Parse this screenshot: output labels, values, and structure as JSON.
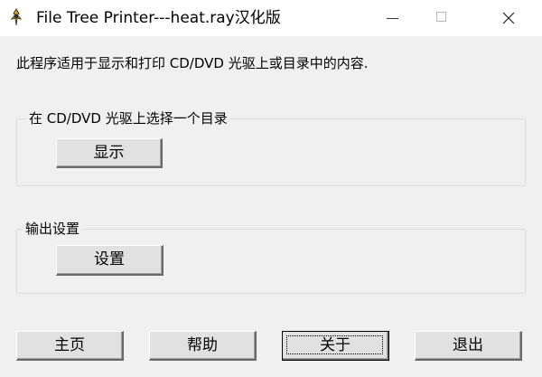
{
  "window": {
    "title": "File Tree Printer---heat.ray汉化版",
    "icons": {
      "app": "app-icon",
      "minimize": "minimize-icon",
      "maximize": "maximize-icon",
      "close": "close-icon"
    }
  },
  "main": {
    "description": "此程序适用于显示和打印 CD/DVD 光驱上或目录中的内容."
  },
  "group_cd": {
    "legend": "在 CD/DVD 光驱上选择一个目录",
    "show_button": "显示"
  },
  "group_output": {
    "legend": "输出设置",
    "setup_button": "设置"
  },
  "footer": {
    "home_button": "主页",
    "help_button": "帮助",
    "about_button": "关于",
    "exit_button": "退出"
  },
  "colors": {
    "window_bg": "#f0f0f0",
    "titlebar_bg": "#ffffff",
    "button_face": "#e1e1e1",
    "groupbox_border": "#dcdcdc"
  }
}
